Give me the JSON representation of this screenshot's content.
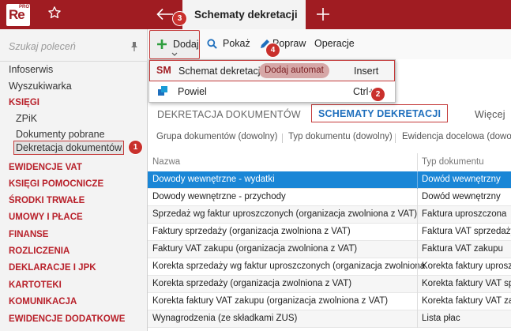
{
  "app": {
    "logo_text": "Re",
    "logo_sup": "PRO",
    "active_tab_title": "Schematy dekretacji"
  },
  "sidebar": {
    "search_placeholder": "Szukaj poleceń",
    "items": [
      {
        "label": "Infoserwis",
        "kind": "plain"
      },
      {
        "label": "Wyszukiwarka",
        "kind": "plain"
      },
      {
        "label": "KSIĘGI",
        "kind": "category"
      },
      {
        "label": "ZPiK",
        "kind": "sub"
      },
      {
        "label": "Dokumenty pobrane",
        "kind": "sub"
      },
      {
        "label": "Dekretacja dokumentów",
        "kind": "sub-selected"
      },
      {
        "label": "EWIDENCJE VAT",
        "kind": "category"
      },
      {
        "label": "KSIĘGI POMOCNICZE",
        "kind": "category"
      },
      {
        "label": "ŚRODKI TRWAŁE",
        "kind": "category"
      },
      {
        "label": "UMOWY I PŁACE",
        "kind": "category"
      },
      {
        "label": "FINANSE",
        "kind": "category"
      },
      {
        "label": "ROZLICZENIA",
        "kind": "category"
      },
      {
        "label": "DEKLARACJE I JPK",
        "kind": "category"
      },
      {
        "label": "KARTOTEKI",
        "kind": "category"
      },
      {
        "label": "KOMUNIKACJA",
        "kind": "category"
      },
      {
        "label": "EWIDENCJE DODATKOWE",
        "kind": "category"
      }
    ]
  },
  "toolbar": {
    "add_label": "Dodaj",
    "show_label": "Pokaż",
    "edit_label": "Popraw",
    "operations_label": "Operacje"
  },
  "dropdown": {
    "item1": {
      "prefix": "SM",
      "label": "Schemat dekretacji",
      "badge": "Dodaj automat",
      "shortcut": "Insert"
    },
    "item2": {
      "label": "Powiel",
      "shortcut": "Ctrl+"
    }
  },
  "tabs": {
    "tab1": "DEKRETACJA DOKUMENTÓW",
    "tab2": "SCHEMATY DEKRETACJI",
    "more": "Więcej"
  },
  "filters": {
    "f1": "Grupa dokumentów (dowolny)",
    "f2": "Typ dokumentu (dowolny)",
    "f3": "Ewidencja docelowa (dowo"
  },
  "grid": {
    "col1": "Nazwa",
    "col2": "Typ dokumentu",
    "rows": [
      {
        "name": "Dowody wewnętrzne - wydatki",
        "type": "Dowód wewnętrzny"
      },
      {
        "name": "Dowody wewnętrzne - przychody",
        "type": "Dowód wewnętrzny"
      },
      {
        "name": "Sprzedaż wg faktur uproszczonych (organizacja zwolniona z VAT)",
        "type": "Faktura uproszczona"
      },
      {
        "name": "Faktury sprzedaży (organizacja zwolniona z VAT)",
        "type": "Faktura VAT sprzedaży"
      },
      {
        "name": "Faktury VAT zakupu  (organizacja zwolniona z VAT)",
        "type": "Faktura VAT zakupu"
      },
      {
        "name": "Korekta sprzedaży wg faktur uproszczonych (organizacja zwolniona",
        "type": "Korekta faktury uprosz"
      },
      {
        "name": "Korekta sprzedaży (organizacja zwolniona z VAT)",
        "type": "Korekta faktury VAT sp"
      },
      {
        "name": "Korekta faktury VAT zakupu (organizacja zwolniona z VAT)",
        "type": "Korekta faktury VAT za"
      },
      {
        "name": "Wynagrodzenia (ze składkami ZUS)",
        "type": "Lista płac"
      }
    ]
  },
  "callouts": [
    "1",
    "2",
    "3",
    "4"
  ],
  "colors": {
    "brand": "#a01c22",
    "selection": "#1a86d6",
    "link": "#1f6fbd",
    "callout": "#c9302c"
  }
}
